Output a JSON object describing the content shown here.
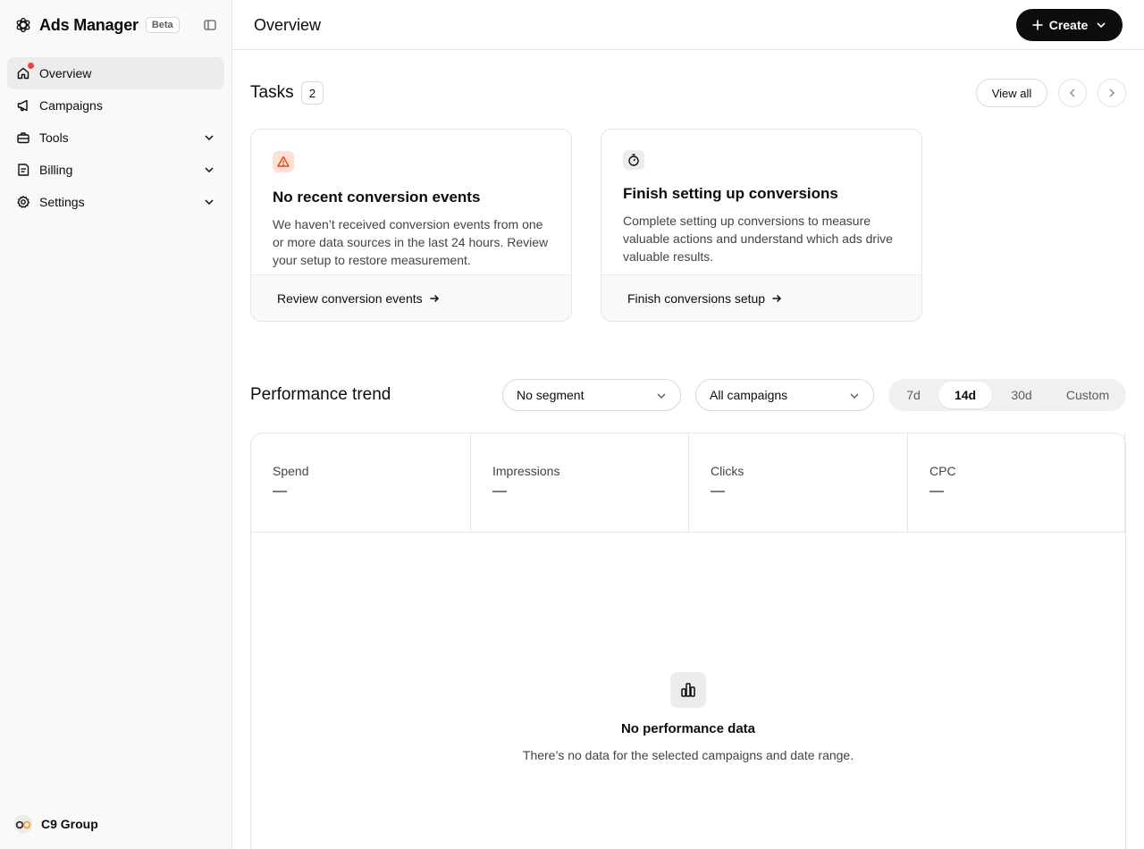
{
  "app": {
    "name": "Ads Manager",
    "badge": "Beta"
  },
  "sidebar": {
    "items": [
      {
        "label": "Overview"
      },
      {
        "label": "Campaigns"
      },
      {
        "label": "Tools"
      },
      {
        "label": "Billing"
      },
      {
        "label": "Settings"
      }
    ],
    "org_name": "C9 Group"
  },
  "header": {
    "title": "Overview",
    "create_label": "Create"
  },
  "tasks": {
    "title": "Tasks",
    "count": "2",
    "view_all_label": "View all",
    "cards": [
      {
        "title": "No recent conversion events",
        "description": "We haven’t received conversion events from one or more data sources in the last 24 hours. Review your setup to restore measurement.",
        "action": "Review conversion events"
      },
      {
        "title": "Finish setting up conversions",
        "description": "Complete setting up conversions to measure valuable actions and understand which ads drive valuable results.",
        "action": "Finish conversions setup"
      }
    ]
  },
  "performance": {
    "title": "Performance trend",
    "segment_select": "No segment",
    "campaign_select": "All campaigns",
    "ranges": [
      {
        "label": "7d",
        "selected": false
      },
      {
        "label": "14d",
        "selected": true
      },
      {
        "label": "30d",
        "selected": false
      },
      {
        "label": "Custom",
        "selected": false
      }
    ],
    "metrics": [
      {
        "label": "Spend",
        "value": "—"
      },
      {
        "label": "Impressions",
        "value": "—"
      },
      {
        "label": "Clicks",
        "value": "—"
      },
      {
        "label": "CPC",
        "value": "—"
      }
    ],
    "empty_title": "No performance data",
    "empty_description": "There’s no data for the selected campaigns and date range."
  },
  "icons": {
    "brand": "openai-logo-icon",
    "collapse": "sidebar-toggle-icon",
    "overview": "home-icon",
    "campaigns": "megaphone-icon",
    "tools": "toolbox-icon",
    "billing": "receipt-icon",
    "settings": "gear-icon",
    "warning": "warning-icon",
    "timer": "stopwatch-icon",
    "chart": "bar-chart-icon"
  },
  "colors": {
    "accent": "#0d0d0d",
    "sidebar_bg": "#f9f9f9",
    "notification_dot": "#ef4146",
    "warning_bg": "#fde0d6",
    "warning_fg": "#e0461d"
  }
}
